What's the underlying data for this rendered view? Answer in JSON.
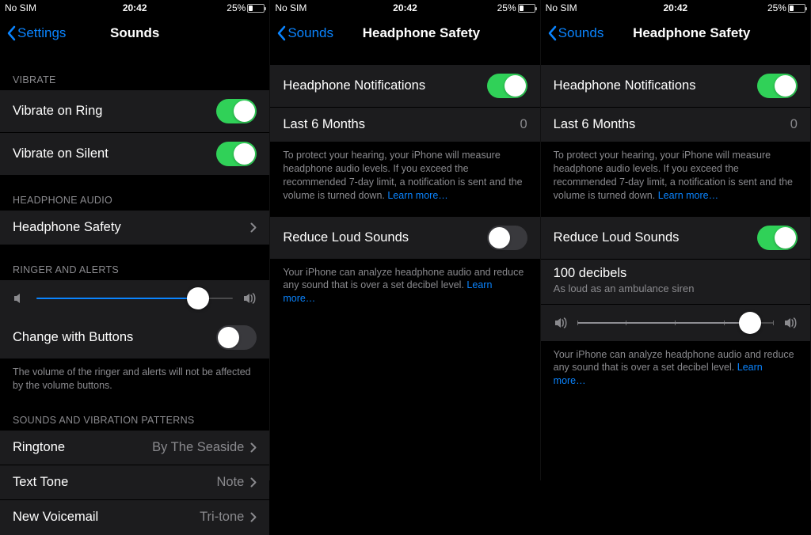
{
  "status": {
    "sim": "No SIM",
    "time": "20:42",
    "battery": "25%"
  },
  "colors": {
    "accent": "#0a84ff",
    "toggleOn": "#30d158"
  },
  "panelA": {
    "back": "Settings",
    "title": "Sounds",
    "sections": {
      "vibrate": {
        "header": "VIBRATE",
        "ringLabel": "Vibrate on Ring",
        "ringOn": true,
        "silentLabel": "Vibrate on Silent",
        "silentOn": true
      },
      "headphoneAudio": {
        "header": "HEADPHONE AUDIO",
        "safetyLabel": "Headphone Safety"
      },
      "ringerAlerts": {
        "header": "RINGER AND ALERTS",
        "sliderValue": 0.82,
        "changeButtonsLabel": "Change with Buttons",
        "changeButtonsOn": false,
        "footer": "The volume of the ringer and alerts will not be affected by the volume buttons."
      },
      "patterns": {
        "header": "SOUNDS AND VIBRATION PATTERNS",
        "ringtone": {
          "label": "Ringtone",
          "value": "By The Seaside"
        },
        "textTone": {
          "label": "Text Tone",
          "value": "Note"
        },
        "voicemail": {
          "label": "New Voicemail",
          "value": "Tri-tone"
        }
      }
    }
  },
  "panelB": {
    "back": "Sounds",
    "title": "Headphone Safety",
    "notifLabel": "Headphone Notifications",
    "notifOn": true,
    "last6Label": "Last 6 Months",
    "last6Value": "0",
    "notifFooter": "To protect your hearing, your iPhone will measure headphone audio levels. If you exceed the recommended 7-day limit, a notification is sent and the volume is turned down.",
    "learnMore": "Learn more…",
    "reduceLabel": "Reduce Loud Sounds",
    "reduceOn": false,
    "reduceFooter": "Your iPhone can analyze headphone audio and reduce any sound that is over a set decibel level."
  },
  "panelC": {
    "back": "Sounds",
    "title": "Headphone Safety",
    "notifLabel": "Headphone Notifications",
    "notifOn": true,
    "last6Label": "Last 6 Months",
    "last6Value": "0",
    "notifFooter": "To protect your hearing, your iPhone will measure headphone audio levels. If you exceed the recommended 7-day limit, a notification is sent and the volume is turned down.",
    "learnMore": "Learn more…",
    "reduceLabel": "Reduce Loud Sounds",
    "reduceOn": true,
    "decibelTitle": "100 decibels",
    "decibelSub": "As loud as an ambulance siren",
    "decibelSlider": 0.88,
    "reduceFooter": "Your iPhone can analyze headphone audio and reduce any sound that is over a set decibel level."
  }
}
